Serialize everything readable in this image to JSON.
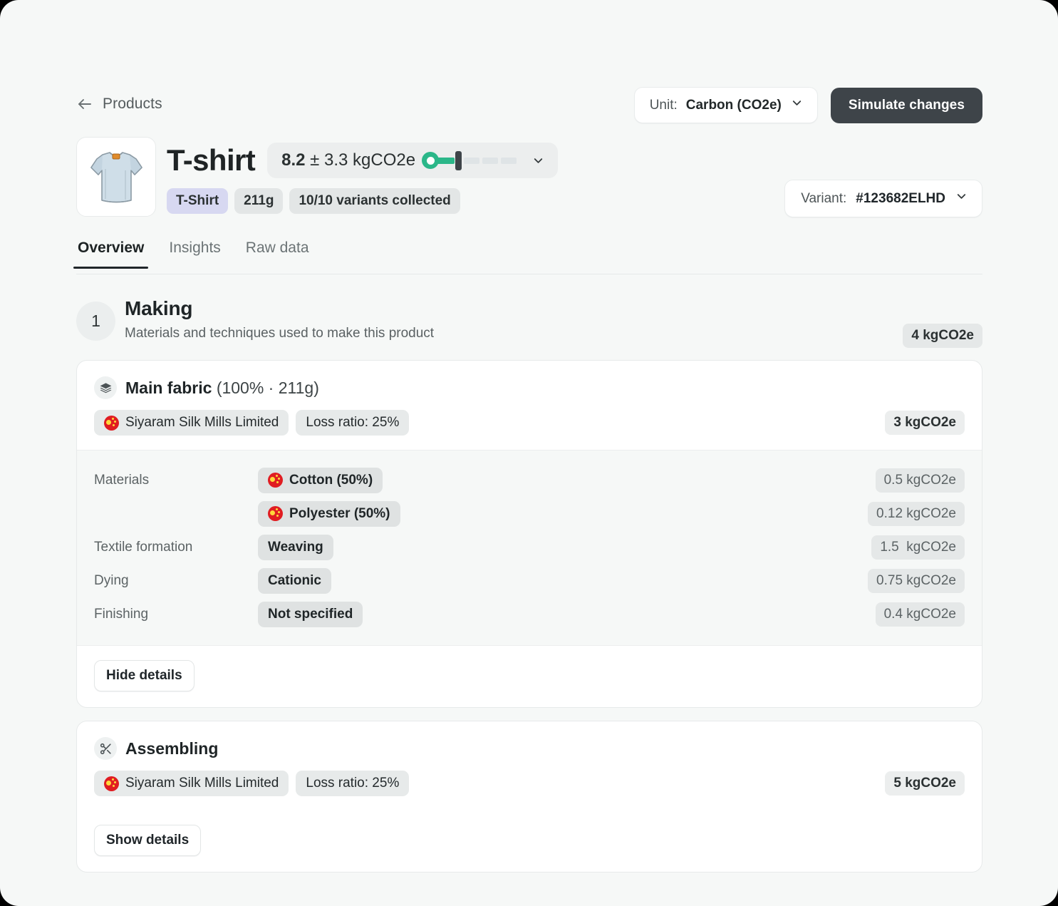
{
  "topbar": {
    "back_label": "Products",
    "back_icon": "arrow-left-icon",
    "unit": {
      "label": "Unit:",
      "value": "Carbon (CO2e)",
      "chevron": "chevron-down-icon"
    },
    "simulate_label": "Simulate changes"
  },
  "product": {
    "thumbnail_alt": "t-shirt-illustration",
    "title": "T-shirt",
    "impact": "8.2 ± 3.3 kgCO2e",
    "impact_value": "8.2",
    "impact_rest": " ± 3.3 kgCO2e",
    "impact_chevron": "chevron-down-icon",
    "badges": [
      {
        "label": "T-Shirt",
        "style": "lilac"
      },
      {
        "label": "211g",
        "style": "grey"
      },
      {
        "label": "10/10 variants collected",
        "style": "grey"
      }
    ],
    "variant": {
      "label": "Variant:",
      "value": "#123682ELHD",
      "chevron": "chevron-down-icon"
    }
  },
  "tabs": [
    {
      "label": "Overview",
      "active": true
    },
    {
      "label": "Insights",
      "active": false
    },
    {
      "label": "Raw data",
      "active": false
    }
  ],
  "stage": {
    "number": "1",
    "title": "Making",
    "subtitle": "Materials and techniques used to make this product",
    "value": "4 kgCO2e"
  },
  "cards": [
    {
      "icon": "layers-icon",
      "name": "Main fabric",
      "meta": "(100% · 211g)",
      "chips": [
        {
          "label": "Siyaram Silk Mills Limited",
          "flag": "china-flag-icon"
        },
        {
          "label": "Loss ratio: 25%",
          "flag": null
        }
      ],
      "value": "3 kgCO2e",
      "expanded": true,
      "details": [
        {
          "label": "Materials",
          "value": "Cotton (50%)",
          "flag": "china-flag-icon",
          "amount": "0.5 kgCO2e"
        },
        {
          "label": "",
          "value": "Polyester (50%)",
          "flag": "china-flag-icon",
          "amount": "0.12 kgCO2e"
        },
        {
          "label": "Textile formation",
          "value": "Weaving",
          "flag": null,
          "amount": "1.5  kgCO2e"
        },
        {
          "label": "Dying",
          "value": "Cationic",
          "flag": null,
          "amount": "0.75 kgCO2e"
        },
        {
          "label": "Finishing",
          "value": "Not specified",
          "flag": null,
          "amount": "0.4 kgCO2e"
        }
      ],
      "toggle_label": "Hide details"
    },
    {
      "icon": "scissors-icon",
      "name": "Assembling",
      "meta": "",
      "chips": [
        {
          "label": "Siyaram Silk Mills Limited",
          "flag": "china-flag-icon"
        },
        {
          "label": "Loss ratio: 25%",
          "flag": null
        }
      ],
      "value": "5 kgCO2e",
      "expanded": false,
      "details": [],
      "toggle_label": "Show details"
    }
  ],
  "colors": {
    "accent_green": "#2bb789",
    "dark_button": "#3e4449",
    "lilac_badge": "#d7d8f1",
    "flag_red": "#e01d22",
    "page_bg": "#f6f8f7"
  }
}
